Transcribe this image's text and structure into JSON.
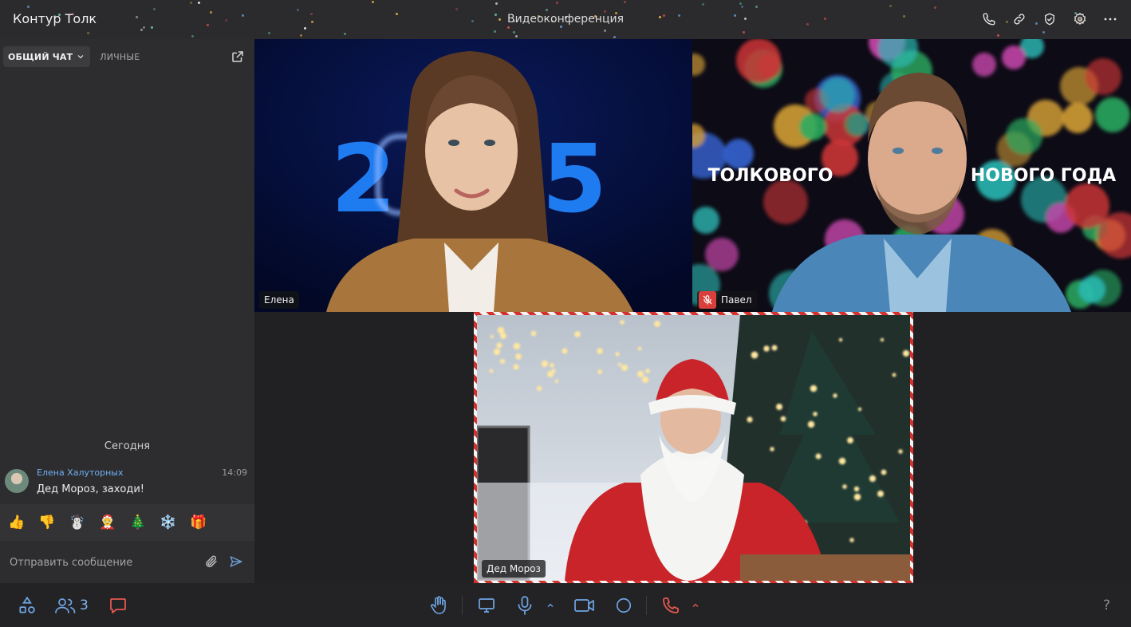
{
  "window": {
    "app_title": "Контур Толк",
    "conference_title": "Видеоконференция"
  },
  "top_actions": [
    "phone-icon",
    "link-icon",
    "shield-check-icon",
    "settings-icon",
    "more-icon"
  ],
  "sidebar": {
    "tabs": [
      {
        "label": "ОБЩИЙ ЧАТ",
        "active": true
      },
      {
        "label": "ЛИЧНЫЕ",
        "active": false
      }
    ],
    "day_separator": "Сегодня",
    "messages": [
      {
        "author": "Елена Халуторных",
        "time": "14:09",
        "text": "Дед Мороз, заходи!"
      }
    ],
    "reactions": [
      "👍",
      "👎",
      "☃️",
      "🤶",
      "🎄",
      "❄️",
      "🎁"
    ],
    "composer": {
      "placeholder": "Отправить сообщение"
    }
  },
  "tiles": [
    {
      "name": "Елена",
      "background_text": "2025",
      "muted": false
    },
    {
      "name": "Павел",
      "background_text_left": "ТОЛКОВОГО",
      "background_text_right": "НОВОГО ГОДА",
      "muted": true
    },
    {
      "name": "Дед Мороз",
      "muted": false
    }
  ],
  "toolbar": {
    "participants_count": "3",
    "help_label": "?"
  },
  "colors": {
    "accent": "#4a95e6",
    "hangup": "#e4574f",
    "chat_icon": "#e4574f",
    "muted_badge": "#d9403b"
  }
}
